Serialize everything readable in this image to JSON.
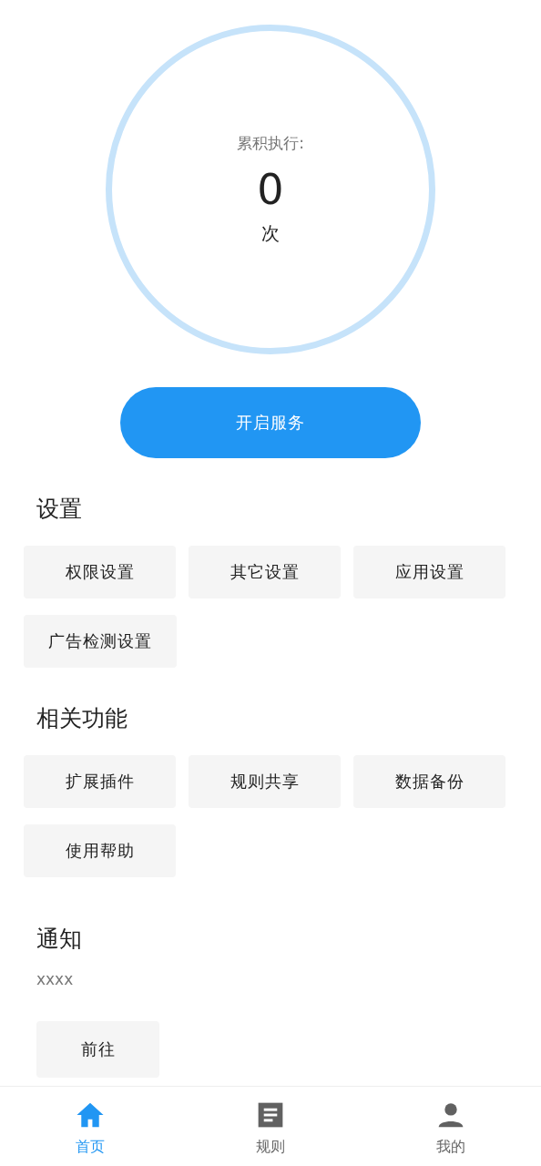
{
  "counter": {
    "label": "累积执行:",
    "value": "0",
    "unit": "次"
  },
  "primary_button": "开启服务",
  "sections": [
    {
      "title": "设置",
      "buttons": [
        "权限设置",
        "其它设置",
        "应用设置",
        "广告检测设置"
      ]
    },
    {
      "title": "相关功能",
      "buttons": [
        "扩展插件",
        "规则共享",
        "数据备份",
        "使用帮助"
      ]
    }
  ],
  "notice": {
    "title": "通知",
    "text": "xxxx",
    "button": "前往"
  },
  "bottom_nav": [
    {
      "kind": "home",
      "label": "首页",
      "selected": true
    },
    {
      "kind": "rules",
      "label": "规则",
      "selected": false
    },
    {
      "kind": "profile",
      "label": "我的",
      "selected": false
    }
  ]
}
